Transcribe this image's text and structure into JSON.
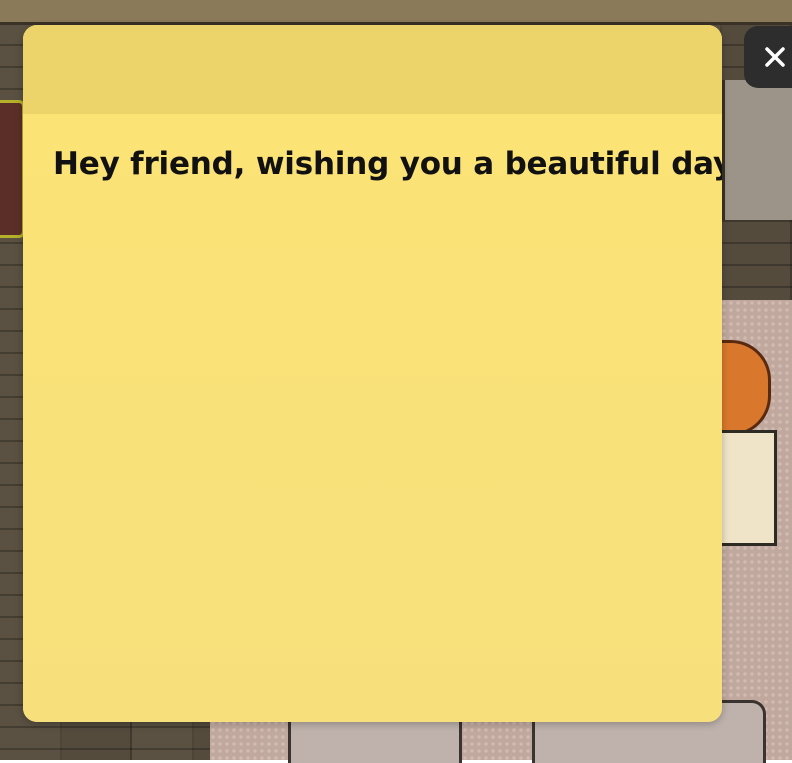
{
  "note": {
    "message": "Hey friend, wishing you a beautiful day!"
  },
  "close_button": {
    "icon": "close-icon"
  },
  "colors": {
    "note_header": "#ecd46a",
    "note_body": "#f8df7a",
    "message_text": "#111111",
    "close_button_bg": "#2e2d2d"
  }
}
